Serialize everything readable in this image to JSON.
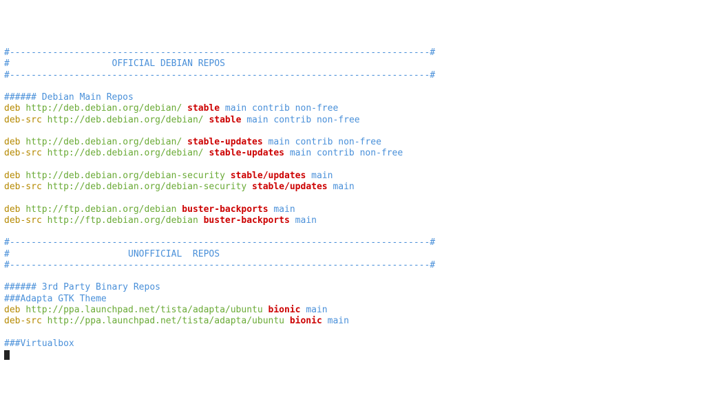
{
  "comment_rule_top": "#------------------------------------------------------------------------------#",
  "comment_header_official": "#                   OFFICIAL DEBIAN REPOS                    ",
  "comment_rule_mid": "#------------------------------------------------------------------------------#",
  "section_main_title": "###### Debian Main Repos",
  "repo_prefix_deb": "deb",
  "repo_prefix_debsrc": "deb-src",
  "sp": " ",
  "main": {
    "url_main": "http://deb.debian.org/debian/",
    "url_sec": "http://deb.debian.org/debian-security",
    "url_ftp": "http://ftp.debian.org/debian",
    "suite_stable": "stable",
    "suite_stable_updates": "stable-updates",
    "suite_stable_sec": "stable/updates",
    "suite_backports": "buster-backports",
    "components_full": "main contrib non-free",
    "components_main": "main"
  },
  "comment_rule_un_top": "#------------------------------------------------------------------------------#",
  "comment_header_unofficial": "#                      UNOFFICIAL  REPOS                       ",
  "comment_rule_un_bot": "#------------------------------------------------------------------------------#",
  "section_3rd_title": "###### 3rd Party Binary Repos",
  "section_adapta_title": "###Adapta GTK Theme",
  "adapta": {
    "url": "http://ppa.launchpad.net/tista/adapta/ubuntu",
    "suite": "bionic",
    "components": "main"
  },
  "section_vbox_title": "###Virtualbox"
}
